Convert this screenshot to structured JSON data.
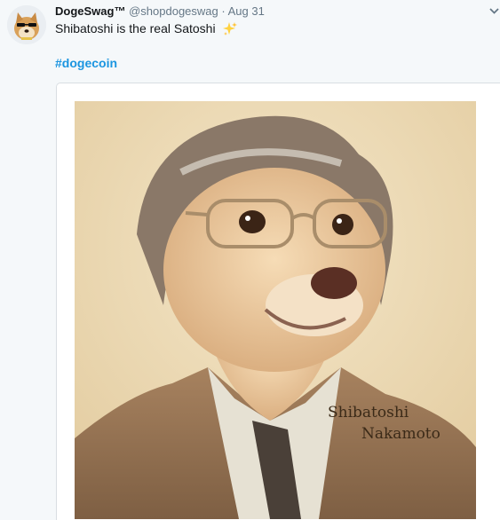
{
  "tweet": {
    "author_name": "DogeSwag™",
    "handle": "@shopdogeswag",
    "separator": "·",
    "date": "Aug 31",
    "text": "Shibatoshi is the real Satoshi",
    "hashtag": "#dogecoin"
  },
  "image": {
    "caption_line1": "Shibatoshi",
    "caption_line2": "Nakamoto"
  },
  "icons": {
    "avatar": "doge-avatar",
    "sparkle": "sparkles-emoji",
    "menu": "chevron-down-icon"
  },
  "colors": {
    "link": "#1b95e0",
    "name": "#14171a",
    "muted": "#657786",
    "background": "#f5f8fa"
  }
}
